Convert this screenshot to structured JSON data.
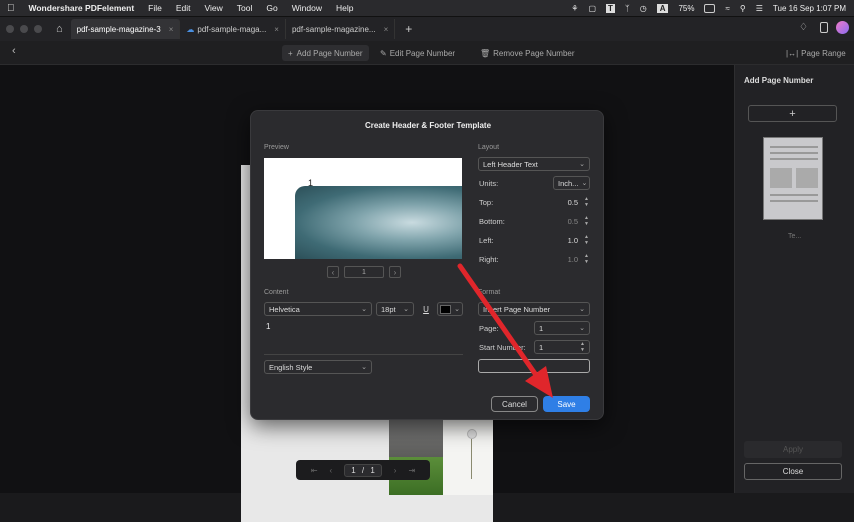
{
  "menubar": {
    "app_name": "Wondershare PDFelement",
    "items": [
      "File",
      "Edit",
      "View",
      "Tool",
      "Go",
      "Window",
      "Help"
    ],
    "battery": "75%",
    "input_source": "A",
    "datetime": "Tue 16 Sep  1:07 PM"
  },
  "tabs": [
    {
      "label": "pdf-sample-magazine-3",
      "active": true
    },
    {
      "label": "pdf-sample-maga...",
      "active": false
    },
    {
      "label": "pdf-sample-magazine...",
      "active": false
    }
  ],
  "new_tab": "+",
  "toolbar": {
    "add": "Add Page Number",
    "edit": "Edit Page Number",
    "remove": "Remove Page Number",
    "range": "Page Range"
  },
  "right_panel": {
    "title": "Add Page Number",
    "add_btn": "+",
    "thumb_label": "Te...",
    "apply": "Apply",
    "close": "Close"
  },
  "page_nav": {
    "current": "1",
    "sep": "/",
    "total": "1"
  },
  "dialog": {
    "title": "Create Header & Footer Template",
    "preview_label": "Preview",
    "preview_number": "1",
    "preview_page": "1",
    "content_label": "Content",
    "font": "Helvetica",
    "size": "18pt",
    "underline": "U",
    "content_text": "1",
    "style": "English Style",
    "layout_label": "Layout",
    "layout_value": "Left Header Text",
    "units_label": "Units:",
    "units_value": "Inch...",
    "top_label": "Top:",
    "top_value": "0.5",
    "bottom_label": "Bottom:",
    "bottom_value": "0.5",
    "left_label": "Left:",
    "left_value": "1.0",
    "right_label": "Right:",
    "right_value": "1.0",
    "format_label": "Format",
    "format_value": "Insert Page Number",
    "page_label": "Page:",
    "page_value": "1",
    "start_label": "Start Number:",
    "start_value": "1",
    "cancel": "Cancel",
    "save": "Save"
  },
  "colors": {
    "accent": "#2f7fe6",
    "arrow": "#e0262b"
  }
}
